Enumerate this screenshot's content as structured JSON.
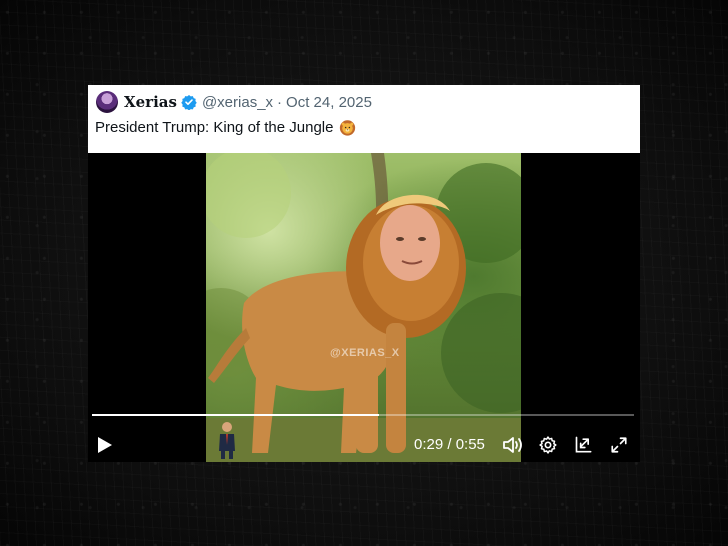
{
  "tweet": {
    "display_name": "Xerias",
    "handle": "@xerias_x",
    "separator": "·",
    "date": "Oct 24, 2025",
    "text": "President Trump: King of the Jungle",
    "emoji": "lion-face-emoji"
  },
  "video": {
    "watermark": "@XERIAS_X",
    "current_time": "0:29",
    "duration": "0:55",
    "time_display": "0:29 / 0:55",
    "progress": 0.53,
    "icons": [
      "play-icon",
      "volume-icon",
      "gear-icon",
      "picture-in-picture-icon",
      "fullscreen-icon"
    ]
  },
  "colors": {
    "verified_badge": "#1d9bf0",
    "text_primary": "#0f1419",
    "text_secondary": "#536471",
    "video_bg": "#000000"
  }
}
